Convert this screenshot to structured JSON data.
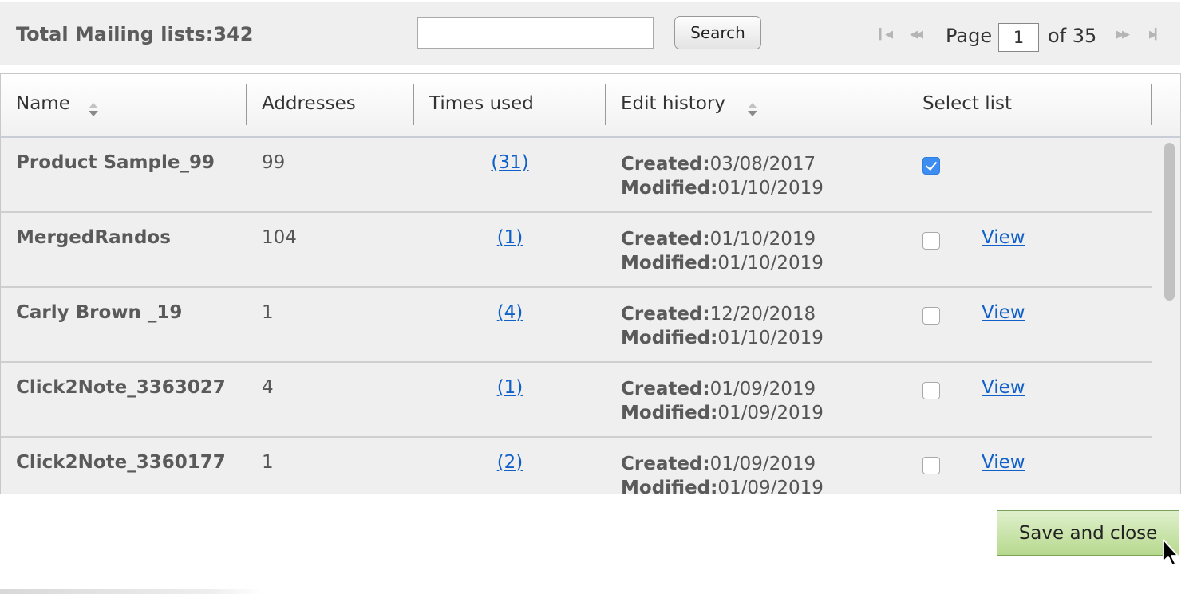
{
  "header": {
    "total_label": "Total Mailing lists:342",
    "search_value": "",
    "search_placeholder": "",
    "search_button": "Search"
  },
  "pager": {
    "page_label": "Page",
    "current_page": "1",
    "of_label": "of 35",
    "first_icon": "first-page-icon",
    "prev_icon": "prev-page-icon",
    "next_icon": "next-page-icon",
    "last_icon": "last-page-icon"
  },
  "table": {
    "columns": [
      "Name",
      "Addresses",
      "Times used",
      "Edit history",
      "Select list"
    ],
    "created_label": "Created:",
    "modified_label": "Modified:",
    "view_label": "View",
    "rows": [
      {
        "name": "Product Sample_99",
        "addresses": "99",
        "times_used": "(31)",
        "created": "03/08/2017",
        "modified": "01/10/2019",
        "selected": true
      },
      {
        "name": "MergedRandos",
        "addresses": "104",
        "times_used": "(1)",
        "created": "01/10/2019",
        "modified": "01/10/2019",
        "selected": false
      },
      {
        "name": "Carly Brown _19",
        "addresses": "1",
        "times_used": "(4)",
        "created": "12/20/2018",
        "modified": "01/10/2019",
        "selected": false
      },
      {
        "name": "Click2Note_3363027",
        "addresses": "4",
        "times_used": "(1)",
        "created": "01/09/2019",
        "modified": "01/09/2019",
        "selected": false
      },
      {
        "name": "Click2Note_3360177",
        "addresses": "1",
        "times_used": "(2)",
        "created": "01/09/2019",
        "modified": "01/09/2019",
        "selected": false
      }
    ]
  },
  "footer": {
    "save_button": "Save and close"
  },
  "colors": {
    "link": "#1060c9",
    "checkbox_checked": "#3d8ef0",
    "save_button_bg": "#c8e4a8",
    "panel_bg": "#efefef"
  }
}
